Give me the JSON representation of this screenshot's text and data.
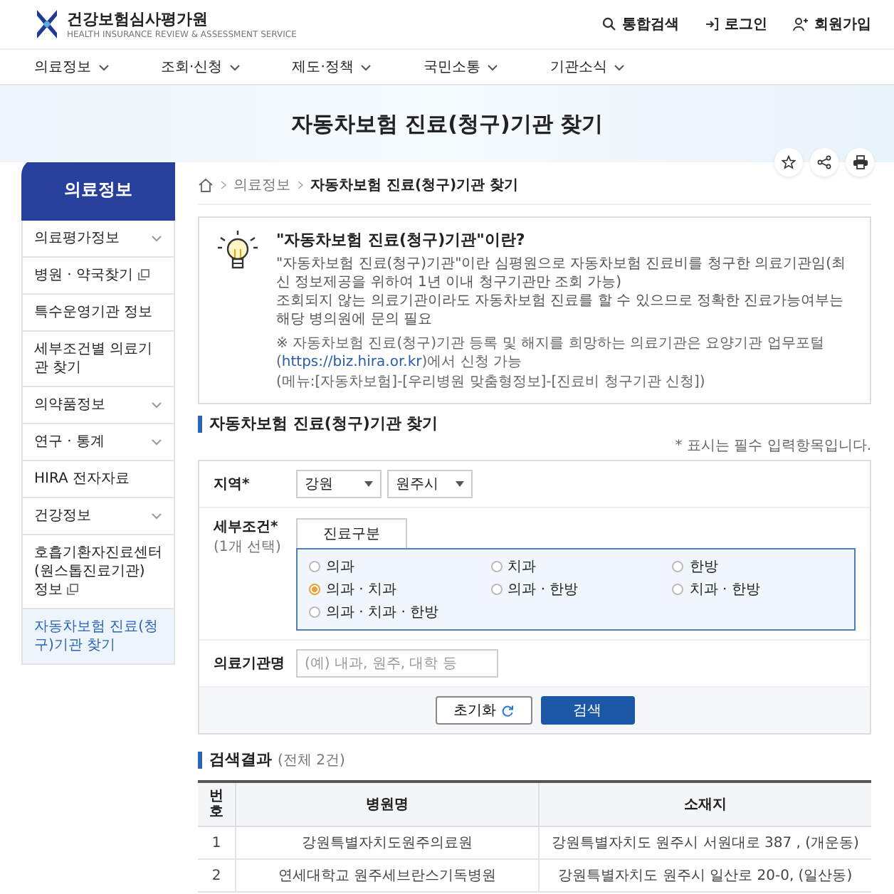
{
  "header": {
    "logo_title": "건강보험심사평가원",
    "logo_subtitle": "HEALTH INSURANCE REVIEW & ASSESSMENT SERVICE",
    "utilities": [
      {
        "kind": "search",
        "label": "통합검색"
      },
      {
        "kind": "login",
        "label": "로그인"
      },
      {
        "kind": "join",
        "label": "회원가입"
      }
    ]
  },
  "nav": [
    "의료정보",
    "조회·신청",
    "제도·정책",
    "국민소통",
    "기관소식"
  ],
  "page_title": "자동차보험 진료(청구)기관 찾기",
  "sidebar": {
    "title": "의료정보",
    "items": [
      {
        "label": "의료평가정보",
        "has_submenu": true,
        "external": false,
        "selected": false
      },
      {
        "label": "병원 · 약국찾기",
        "has_submenu": false,
        "external": true,
        "selected": false
      },
      {
        "label": "특수운영기관 정보",
        "has_submenu": false,
        "external": false,
        "selected": false
      },
      {
        "label": "세부조건별 의료기관 찾기",
        "has_submenu": false,
        "external": false,
        "selected": false
      },
      {
        "label": "의약품정보",
        "has_submenu": true,
        "external": false,
        "selected": false
      },
      {
        "label": "연구 · 통계",
        "has_submenu": true,
        "external": false,
        "selected": false
      },
      {
        "label": "HIRA 전자자료",
        "has_submenu": false,
        "external": false,
        "selected": false
      },
      {
        "label": "건강정보",
        "has_submenu": true,
        "external": false,
        "selected": false
      },
      {
        "label": "호흡기환자진료센터(원스톱진료기관) 정보",
        "has_submenu": false,
        "external": true,
        "selected": false
      },
      {
        "label": "자동차보험 진료(청구)기관 찾기",
        "has_submenu": false,
        "external": false,
        "selected": true
      }
    ]
  },
  "breadcrumb": [
    "의료정보",
    "자동차보험 진료(청구)기관 찾기"
  ],
  "info": {
    "title": "\"자동차보험 진료(청구)기관\"이란?",
    "bullets": [
      "\"자동차보험 진료(청구)기관\"이란 심평원으로 자동차보험 진료비를 청구한 의료기관임(최신 정보제공을 위하여 1년 이내 청구기관만 조회 가능)",
      "조회되지 않는 의료기관이라도 자동차보험 진료를 할 수 있으므로 정확한 진료가능여부는 해당 병의원에 문의 필요"
    ],
    "note_before": "※ 자동차보험 진료(청구)기관 등록 및 해지를 희망하는 의료기관은 요양기관 업무포털(",
    "note_link": "https://biz.hira.or.kr",
    "note_after": ")에서 신청 가능",
    "menu_path": "(메뉴:[자동차보험]-[우리병원 맞춤형정보]-[진료비 청구기관 신청])"
  },
  "search": {
    "title": "자동차보험 진료(청구)기관 찾기",
    "required_note": "* 표시는 필수 입력항목입니다.",
    "region": {
      "label": "지역*",
      "province": "강원",
      "city": "원주시"
    },
    "detail": {
      "label": "세부조건*",
      "hint": "(1개 선택)",
      "tab": "진료구분",
      "options": [
        {
          "label": "의과",
          "selected": false
        },
        {
          "label": "치과",
          "selected": false
        },
        {
          "label": "한방",
          "selected": false
        },
        {
          "label": "의과 · 치과",
          "selected": true
        },
        {
          "label": "의과 · 한방",
          "selected": false
        },
        {
          "label": "치과 · 한방",
          "selected": false
        },
        {
          "label": "의과 · 치과 · 한방",
          "selected": false
        }
      ]
    },
    "name": {
      "label": "의료기관명",
      "placeholder": "(예) 내과, 원주, 대학 등"
    },
    "buttons": [
      {
        "kind": "reset",
        "label": "초기화"
      },
      {
        "kind": "search",
        "label": "검색"
      }
    ]
  },
  "results": {
    "title": "검색결과",
    "count": "(전체 2건)",
    "columns": [
      "번호",
      "병원명",
      "소재지"
    ],
    "rows": [
      [
        "1",
        "강원특별자치도원주의료원",
        "강원특별자치도 원주시 서원대로 387 , (개운동)"
      ],
      [
        "2",
        "연세대학교 원주세브란스기독병원",
        "강원특별자치도 원주시 일산로 20-0, (일산동)"
      ]
    ]
  }
}
